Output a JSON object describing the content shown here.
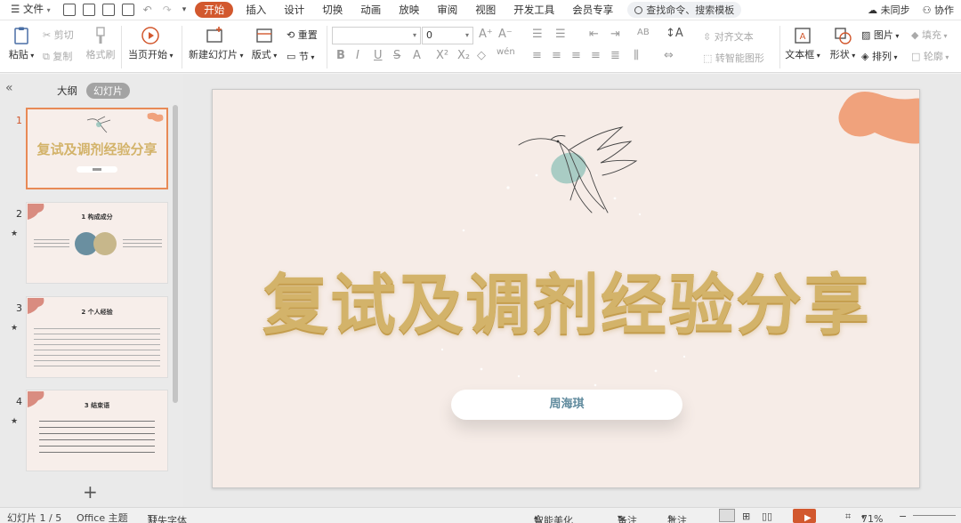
{
  "menu": {
    "file": "文件",
    "tabs": [
      "开始",
      "插入",
      "设计",
      "切换",
      "动画",
      "放映",
      "审阅",
      "视图",
      "开发工具",
      "会员专享"
    ],
    "search_placeholder": "查找命令、搜索模板",
    "sync": "未同步",
    "collab": "协作"
  },
  "ribbon": {
    "paste": "粘贴",
    "cut": "剪切",
    "copy": "复制",
    "format_painter": "格式刷",
    "start_from_current": "当页开始",
    "new_slide": "新建幻灯片",
    "layout": "版式",
    "section": "节",
    "reset": "重置",
    "font_size": "0",
    "align_text": "对齐文本",
    "smartart": "转智能图形",
    "textbox": "文本框",
    "shape": "形状",
    "arrange": "排列",
    "picture": "图片",
    "fill": "填充",
    "outline": "轮廓"
  },
  "panel": {
    "outline_tab": "大纲",
    "slides_tab": "幻灯片",
    "thumbs": [
      {
        "num": "1",
        "title": "复试及调剂经验分享"
      },
      {
        "num": "2",
        "title": "1 构成成分"
      },
      {
        "num": "3",
        "title": "2 个人经验"
      },
      {
        "num": "4",
        "title": "3 结束语"
      }
    ]
  },
  "slide": {
    "title": "复试及调剂经验分享",
    "presenter": "周海琪"
  },
  "status": {
    "slide_info": "幻灯片 1 / 5",
    "theme": "Office 主题",
    "missing_font": "缺失字体",
    "beautify": "智能美化",
    "notes": "备注",
    "comments": "批注",
    "zoom": "71%"
  },
  "colors": {
    "accent": "#d2582e",
    "title_gold": "#d3b36a",
    "blob": "#f0a27c",
    "presenter_text": "#5f8a9d",
    "slide_bg": "#f6ece7"
  }
}
